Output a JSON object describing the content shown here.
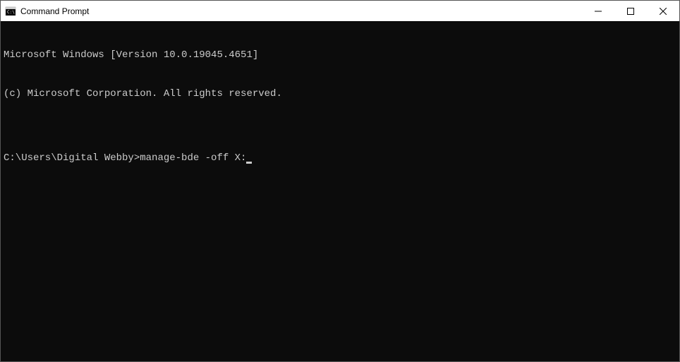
{
  "window": {
    "title": "Command Prompt"
  },
  "terminal": {
    "line1": "Microsoft Windows [Version 10.0.19045.4651]",
    "line2": "(c) Microsoft Corporation. All rights reserved.",
    "blank": "",
    "prompt": "C:\\Users\\Digital Webby>",
    "command": "manage-bde -off X:"
  }
}
